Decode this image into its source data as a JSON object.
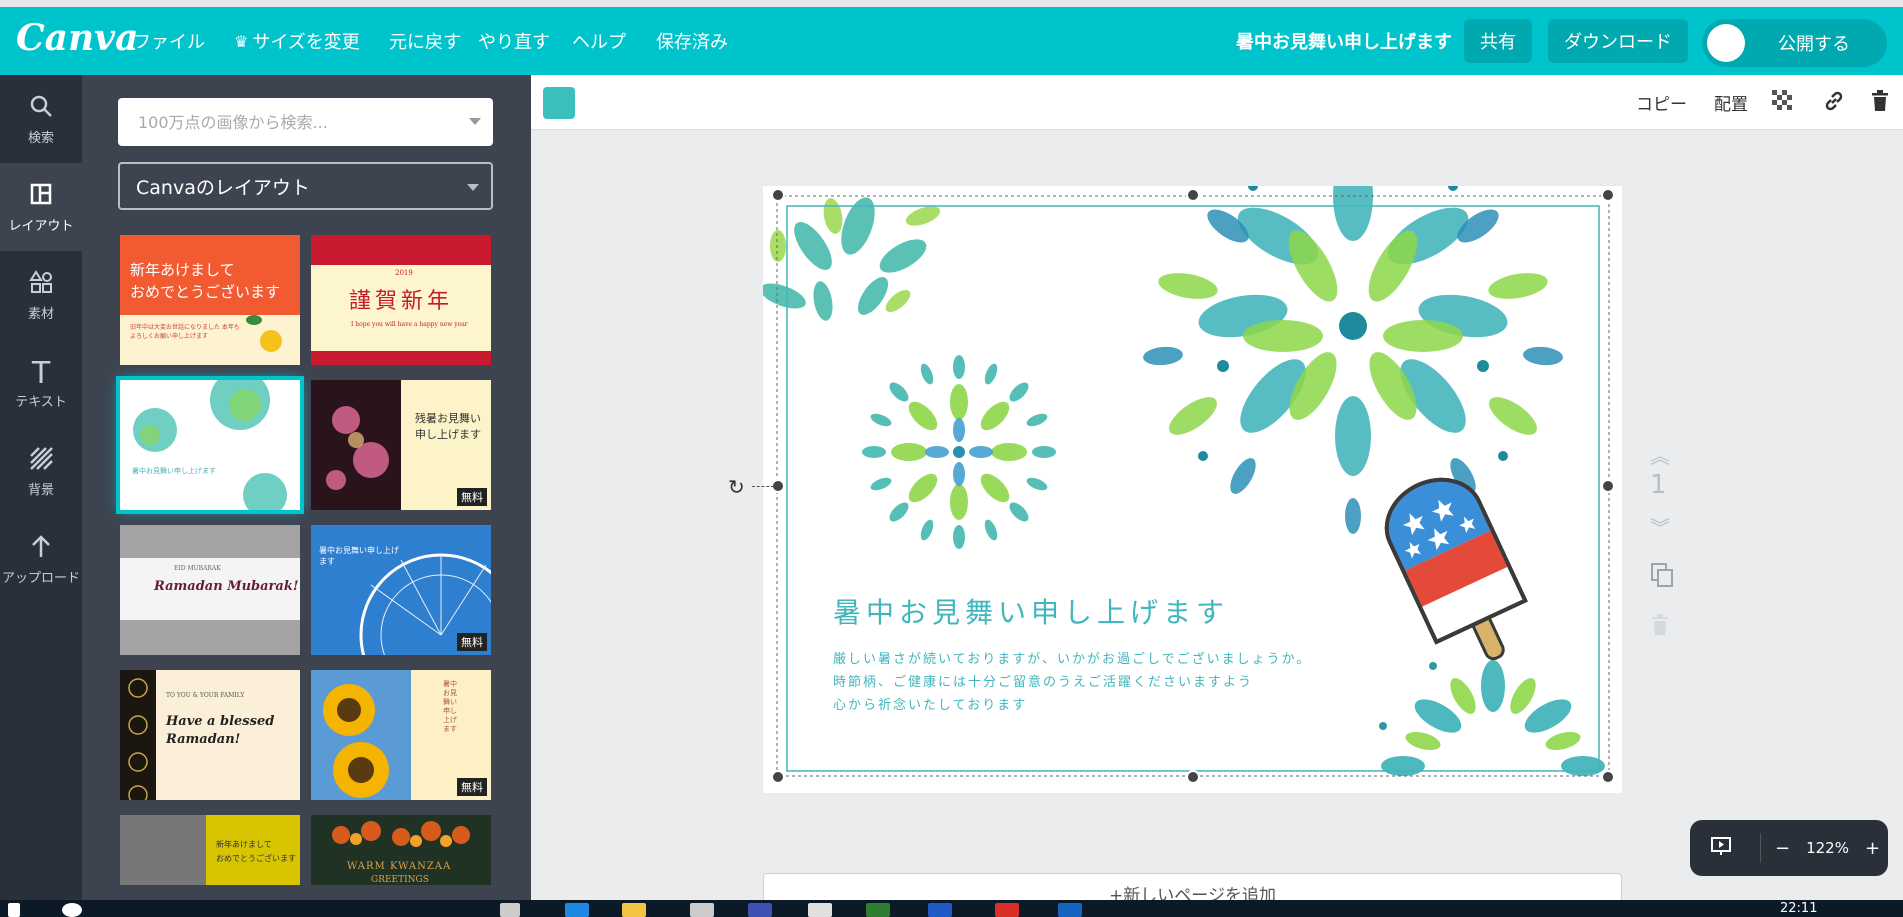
{
  "app": {
    "logo": "Canva",
    "menu": [
      "ファイル",
      "サイズを変更",
      "元に戻す",
      "やり直す",
      "ヘルプ",
      "保存済み"
    ],
    "crown_icon": "crown-icon",
    "doc_title": "暑中お見舞い申し上げます",
    "share_label": "共有",
    "download_label": "ダウンロード",
    "publish_label": "公開する",
    "accent": "#00c4cc"
  },
  "rail": [
    {
      "label": "検索",
      "icon": "search-icon"
    },
    {
      "label": "レイアウト",
      "icon": "layout-icon"
    },
    {
      "label": "素材",
      "icon": "elements-icon"
    },
    {
      "label": "テキスト",
      "icon": "text-icon"
    },
    {
      "label": "背景",
      "icon": "background-icon"
    },
    {
      "label": "アップロード",
      "icon": "upload-icon"
    }
  ],
  "panel": {
    "search_placeholder": "100万点の画像から検索...",
    "layout_select": "Canvaのレイアウト",
    "free_badge": "無料",
    "templates": [
      {
        "line1": "新年あけまして",
        "line2": "おめでとうございます",
        "sub": "旧年中は大変お世話になりました 本年もよろしくお願い申し上げます"
      },
      {
        "small": "2019",
        "line1": "謹賀新年",
        "sub": "I hope you will have a happy new year"
      },
      {
        "line1": "暑中お見舞い申し上げます"
      },
      {
        "line1": "残暑お見舞い",
        "line2": "申し上げます"
      },
      {
        "small": "EID MUBARAK",
        "line1": "Ramadan Mubarak!"
      },
      {
        "line1": "暑中お見舞い申し上げます"
      },
      {
        "small": "TO YOU & YOUR FAMILY",
        "line1": "Have a blessed",
        "line2": "Ramadan!"
      },
      {
        "line1": "暑中お見舞い申し上げます"
      },
      {
        "line1": "新年あけまして",
        "line2": "おめでとうございます"
      },
      {
        "line1": "WARM KWANZAA",
        "line2": "GREETINGS"
      }
    ]
  },
  "toolbar": {
    "copy_label": "コピー",
    "arrange_label": "配置",
    "transparency_icon": "transparency-icon",
    "link_icon": "link-icon",
    "trash_icon": "trash-icon",
    "swatch_color": "#3bbfbf"
  },
  "card": {
    "title": "暑中お見舞い申し上げます",
    "body": [
      "厳しい暑さが続いておりますが、いかがお過ごしでございましょうか。",
      "時節柄、ご健康には十分ご留意のうえご活躍くださいますよう",
      "心から祈念いたしております"
    ]
  },
  "page": {
    "number": "1",
    "add_page_label": "+新しいページを追加"
  },
  "zoom": {
    "level": "122%"
  },
  "taskbar": {
    "time": "22:11"
  }
}
